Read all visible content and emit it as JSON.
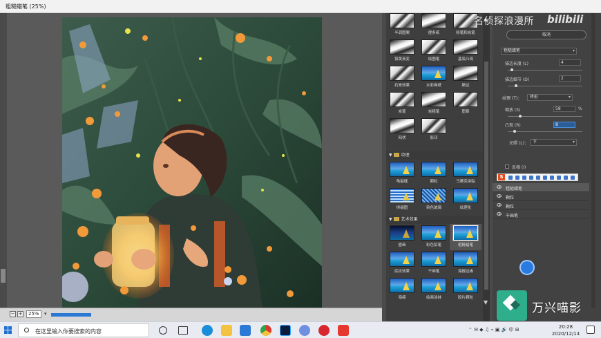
{
  "window": {
    "title": "粗糙蜡笔 (25%)"
  },
  "zoom": {
    "value": "25%"
  },
  "watermark": {
    "channel": "名侦探浪漫所",
    "site": "bilibili",
    "editor": "万兴喵影"
  },
  "gallery": {
    "top_labels": [
      "半调图案",
      "便条纸",
      "粉笔和炭笔",
      "铬黄渐变",
      "绘图笔",
      "基底凸现",
      "石膏效果",
      "水彩画纸",
      "撕边",
      "炭笔",
      "炭精笔",
      "图章",
      "网状",
      "影印"
    ],
    "categories": [
      {
        "name": "纹理",
        "items": [
          "龟裂缝",
          "颗粒",
          "马赛克拼贴",
          "拼缀图",
          "染色玻璃",
          "纹理化"
        ]
      },
      {
        "name": "艺术效果",
        "items": [
          "壁画",
          "彩色铅笔",
          "粗糙蜡笔",
          "底纹效果",
          "干画笔",
          "海报边缘",
          "海绵",
          "绘画涂抹",
          "胶片颗粒"
        ]
      }
    ]
  },
  "panel": {
    "cancel_label": "取消",
    "filter_select": "粗糙蜡笔",
    "stroke_length_label": "描边长度 (L)",
    "stroke_length": "4",
    "stroke_detail_label": "描边细节 (D)",
    "stroke_detail": "2",
    "texture_label": "纹理 (T)：",
    "texture_value": "砖形",
    "scaling_label": "缩放 (S)",
    "scaling": "58",
    "scaling_unit": "%",
    "relief_label": "凸现 (R)",
    "relief": "8",
    "light_label": "光照 (L)：",
    "light_value": "下",
    "invert_label": "反相 (I)",
    "layers": [
      "粗糙蜡笔",
      "颗粒",
      "颗粒",
      "干画笔"
    ]
  },
  "taskbar": {
    "search_placeholder": "在这里输入你要搜索的内容",
    "time": "20:28",
    "date": "2020/12/14"
  },
  "colors": {
    "accent": "#2b78d4",
    "ps_dark": "#424242"
  }
}
